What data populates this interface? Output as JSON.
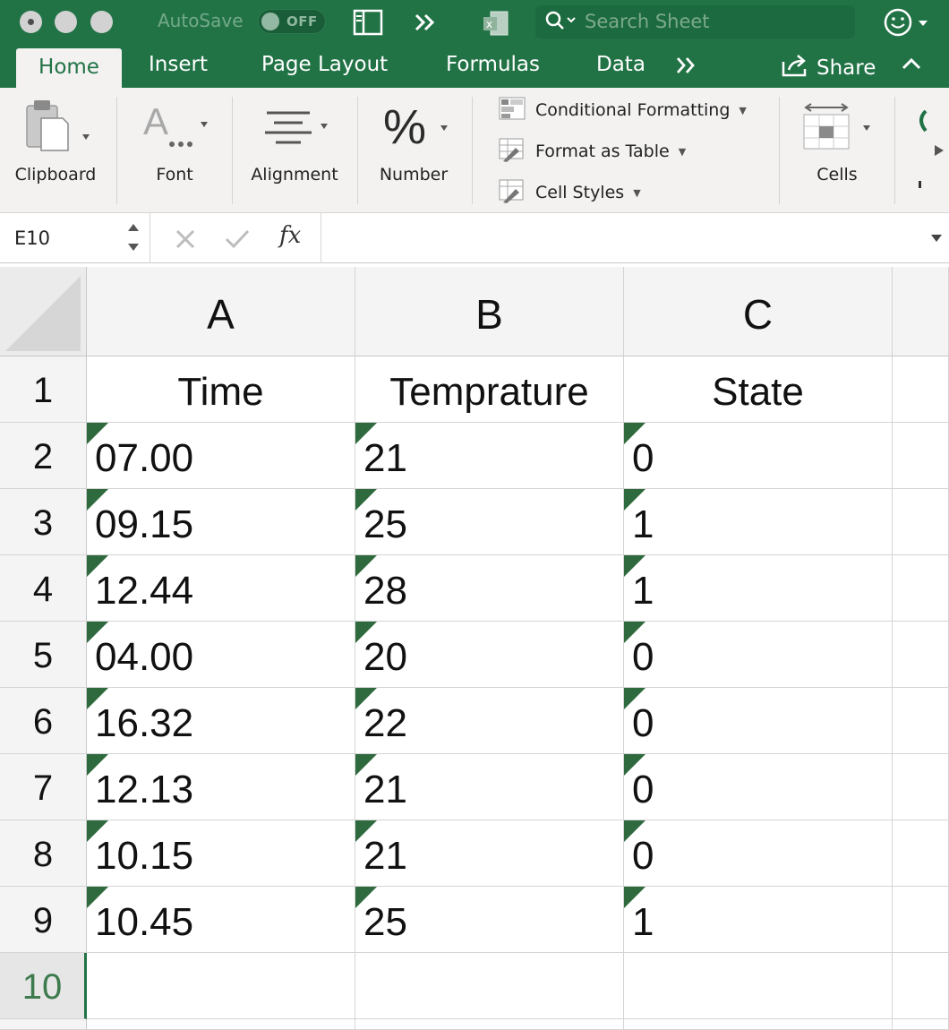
{
  "titlebar": {
    "autosave_label": "AutoSave",
    "autosave_state": "OFF",
    "search_placeholder": "Search Sheet"
  },
  "tabs": [
    "Home",
    "Insert",
    "Page Layout",
    "Formulas",
    "Data"
  ],
  "share_label": "Share",
  "ribbon": {
    "clipboard": "Clipboard",
    "font": "Font",
    "alignment": "Alignment",
    "number": "Number",
    "conditional_formatting": "Conditional Formatting",
    "format_as_table": "Format as Table",
    "cell_styles": "Cell Styles",
    "cells": "Cells"
  },
  "formula_bar": {
    "name_box": "E10",
    "fx": "fx"
  },
  "grid": {
    "columns": [
      "A",
      "B",
      "C"
    ],
    "rows": [
      "1",
      "2",
      "3",
      "4",
      "5",
      "6",
      "7",
      "8",
      "9",
      "10"
    ],
    "selected_row": "10",
    "header_row": [
      "Time",
      "Temprature",
      "State"
    ],
    "data": [
      [
        "07.00",
        "21",
        "0"
      ],
      [
        "09.15",
        "25",
        "1"
      ],
      [
        "12.44",
        "28",
        "1"
      ],
      [
        "04.00",
        "20",
        "0"
      ],
      [
        "16.32",
        "22",
        "0"
      ],
      [
        "12.13",
        "21",
        "0"
      ],
      [
        "10.15",
        "21",
        "0"
      ],
      [
        "10.45",
        "25",
        "1"
      ]
    ]
  },
  "colors": {
    "brand_green": "#217346",
    "error_triangle": "#2f6a3f"
  }
}
